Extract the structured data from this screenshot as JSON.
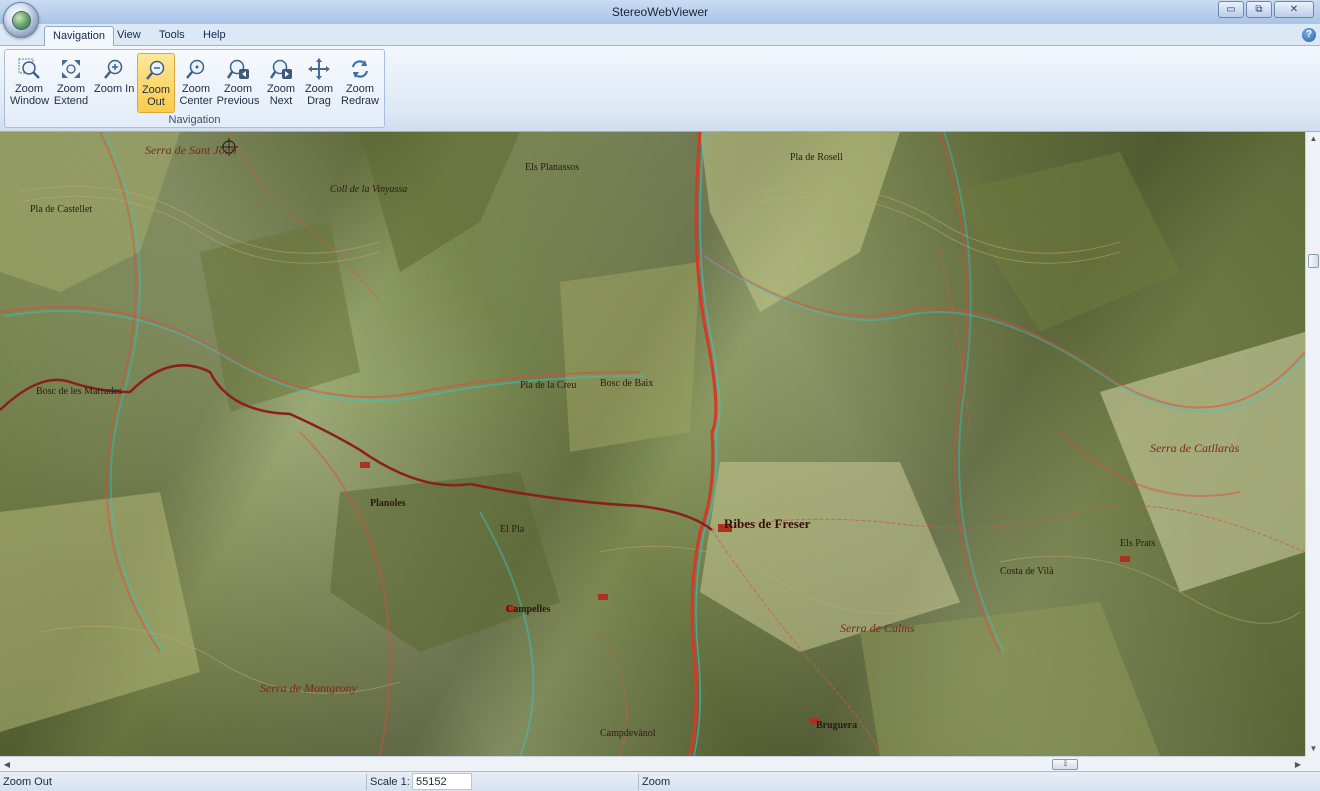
{
  "window": {
    "title": "StereoWebViewer",
    "controls": {
      "minimize": "▭",
      "maximize": "⧉",
      "close": "✕"
    }
  },
  "menu": {
    "tabs": [
      {
        "label": "Navigation",
        "active": true
      },
      {
        "label": "View",
        "active": false
      },
      {
        "label": "Tools",
        "active": false
      },
      {
        "label": "Help",
        "active": false
      }
    ],
    "help_icon": "?"
  },
  "ribbon": {
    "group_label": "Navigation",
    "buttons": [
      {
        "l1": "Zoom",
        "l2": "Window",
        "icon": "zoom-window-icon"
      },
      {
        "l1": "Zoom",
        "l2": "Extend",
        "icon": "zoom-extend-icon"
      },
      {
        "l1": "Zoom In",
        "l2": "",
        "icon": "zoom-in-icon"
      },
      {
        "l1": "Zoom",
        "l2": "Out",
        "icon": "zoom-out-icon",
        "active": true
      },
      {
        "l1": "Zoom",
        "l2": "Center",
        "icon": "zoom-center-icon"
      },
      {
        "l1": "Zoom",
        "l2": "Previous",
        "icon": "zoom-previous-icon"
      },
      {
        "l1": "Zoom",
        "l2": "Next",
        "icon": "zoom-next-icon"
      },
      {
        "l1": "Zoom",
        "l2": "Drag",
        "icon": "zoom-drag-icon"
      },
      {
        "l1": "Zoom",
        "l2": "Redraw",
        "icon": "zoom-redraw-icon"
      }
    ]
  },
  "map": {
    "labels": [
      "Serra de Sant Joan",
      "Pla de Castellet",
      "Pla de Rosell",
      "Coll de la Vinyassa",
      "Els Planassos",
      "Bosc de Baix",
      "Ribes de Freser",
      "Planoles",
      "Campelles",
      "El Pla",
      "Els Prats",
      "Serra de Montgrony",
      "Serra de Catllaràs",
      "Bruguera",
      "Bosc de les Marrades",
      "Pla de la Creu",
      "Costa de Vilà",
      "Campdevànol",
      "Serra de Calms"
    ],
    "colors": {
      "river": "#d23a2a",
      "road": "#8a1f1f",
      "contour": "#c8a96a"
    }
  },
  "statusbar": {
    "mode": "Zoom Out",
    "scale_label": "Scale 1:",
    "scale_value": "55152",
    "tool": "Zoom"
  },
  "scroll": {
    "up": "▲",
    "down": "▼",
    "left": "◀",
    "right": "▶",
    "thumb_grip": "⁞⁞⁞"
  }
}
